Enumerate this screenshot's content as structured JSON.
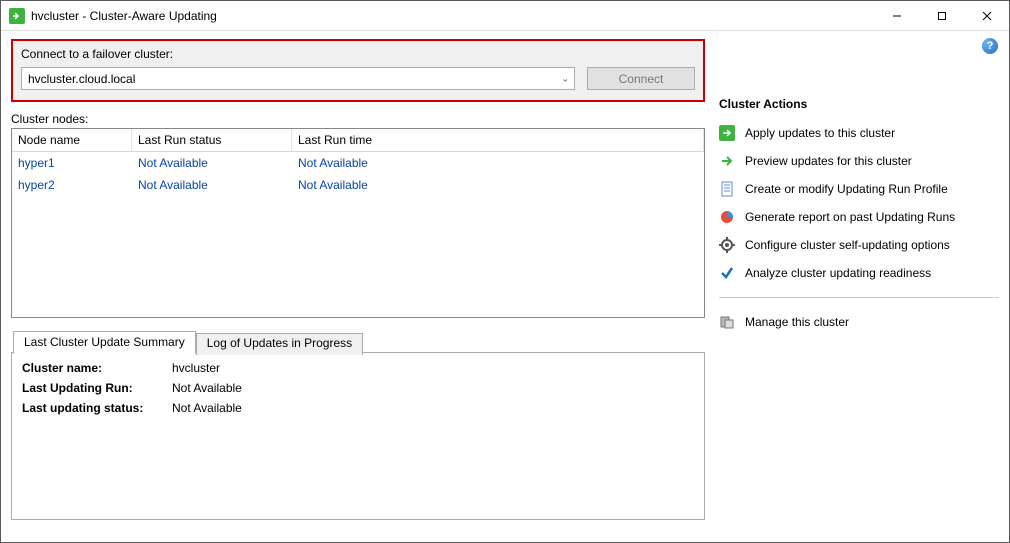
{
  "window": {
    "title": "hvcluster - Cluster-Aware Updating"
  },
  "connect": {
    "label": "Connect to a failover cluster:",
    "value": "hvcluster.cloud.local",
    "button": "Connect"
  },
  "nodes": {
    "label": "Cluster nodes:",
    "columns": {
      "name": "Node name",
      "status": "Last Run status",
      "time": "Last Run time"
    },
    "rows": [
      {
        "name": "hyper1",
        "status": "Not Available",
        "time": "Not Available"
      },
      {
        "name": "hyper2",
        "status": "Not Available",
        "time": "Not Available"
      }
    ]
  },
  "tabs": {
    "summary_label": "Last Cluster Update Summary",
    "log_label": "Log of Updates in Progress"
  },
  "summary": {
    "cluster_key": "Cluster name:",
    "cluster_val": "hvcluster",
    "last_run_key": "Last Updating Run:",
    "last_run_val": "Not Available",
    "last_status_key": "Last updating status:",
    "last_status_val": "Not Available"
  },
  "actions": {
    "heading": "Cluster Actions",
    "apply": "Apply updates to this cluster",
    "preview": "Preview updates for this cluster",
    "profile": "Create or modify Updating Run Profile",
    "report": "Generate report on past Updating Runs",
    "configure": "Configure cluster self-updating options",
    "analyze": "Analyze cluster updating readiness",
    "manage": "Manage this cluster"
  }
}
